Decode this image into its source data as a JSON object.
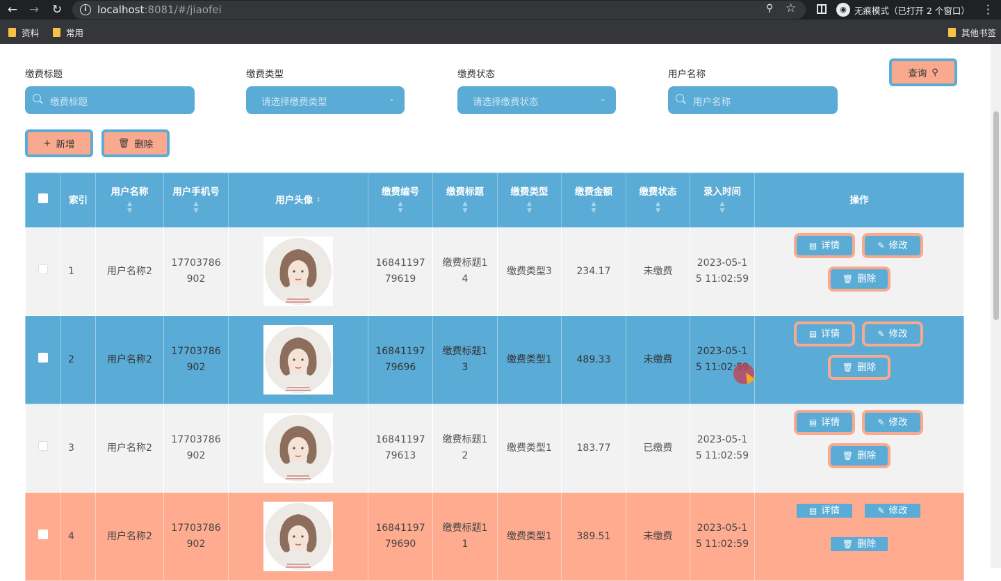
{
  "browser": {
    "url_host": "localhost",
    "url_rest": ":8081/#/jiaofei",
    "incognito_label": "无痕模式（已打开 2 个窗口）",
    "bookmarks": [
      "资料",
      "常用"
    ],
    "other_bookmarks": "其他书签"
  },
  "filters": {
    "title_label": "缴费标题",
    "title_placeholder": "缴费标题",
    "type_label": "缴费类型",
    "type_placeholder": "请选择缴费类型",
    "status_label": "缴费状态",
    "status_placeholder": "请选择缴费状态",
    "user_label": "用户名称",
    "user_placeholder": "用户名称",
    "query_button": "查询"
  },
  "toolbar": {
    "add_button": "新增",
    "delete_button": "删除"
  },
  "table": {
    "headers": {
      "index": "索引",
      "user_name": "用户名称",
      "user_phone": "用户手机号",
      "avatar": "用户头像",
      "fee_no": "缴费编号",
      "fee_title": "缴费标题",
      "fee_type": "缴费类型",
      "fee_amount": "缴费金额",
      "fee_status": "缴费状态",
      "created_at": "录入时间",
      "actions": "操作"
    },
    "action_labels": {
      "detail": "详情",
      "edit": "修改",
      "delete": "删除"
    },
    "rows": [
      {
        "index": "1",
        "user_name": "用户名称2",
        "phone_a": "17703786",
        "phone_b": "902",
        "fee_no_a": "16841197",
        "fee_no_b": "79619",
        "title_a": "缴费标题1",
        "title_b": "4",
        "type": "缴费类型3",
        "amount": "234.17",
        "status": "未缴费",
        "time_a": "2023-05-1",
        "time_b": "5 11:02:59"
      },
      {
        "index": "2",
        "user_name": "用户名称2",
        "phone_a": "17703786",
        "phone_b": "902",
        "fee_no_a": "16841197",
        "fee_no_b": "79696",
        "title_a": "缴费标题1",
        "title_b": "3",
        "type": "缴费类型1",
        "amount": "489.33",
        "status": "未缴费",
        "time_a": "2023-05-1",
        "time_b": "5 11:02:59"
      },
      {
        "index": "3",
        "user_name": "用户名称2",
        "phone_a": "17703786",
        "phone_b": "902",
        "fee_no_a": "16841197",
        "fee_no_b": "79613",
        "title_a": "缴费标题1",
        "title_b": "2",
        "type": "缴费类型1",
        "amount": "183.77",
        "status": "已缴费",
        "time_a": "2023-05-1",
        "time_b": "5 11:02:59"
      },
      {
        "index": "4",
        "user_name": "用户名称2",
        "phone_a": "17703786",
        "phone_b": "902",
        "fee_no_a": "16841197",
        "fee_no_b": "79690",
        "title_a": "缴费标题1",
        "title_b": "1",
        "type": "缴费类型1",
        "amount": "389.51",
        "status": "未缴费",
        "time_a": "2023-05-1",
        "time_b": "5 11:02:59"
      }
    ]
  },
  "colors": {
    "primary_blue": "#5aabd6",
    "accent_orange": "#f9a98e",
    "row_orange": "#ffab8f",
    "row_light": "#f2f2f2"
  }
}
